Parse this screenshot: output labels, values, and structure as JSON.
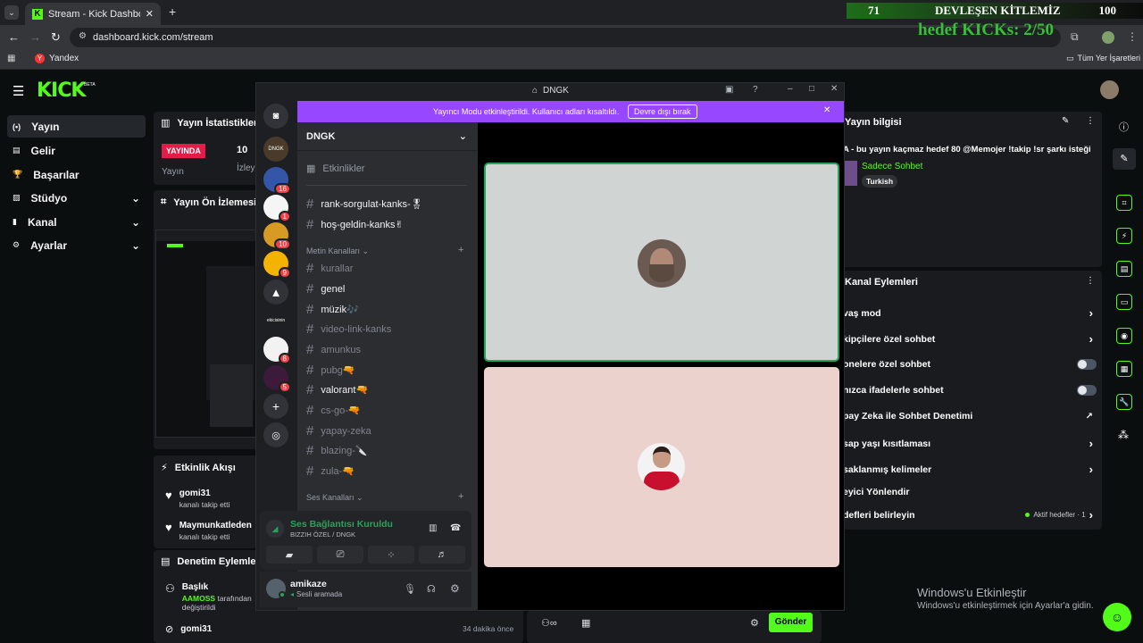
{
  "browser": {
    "tab_title": "Stream - Kick Dashboard",
    "url": "dashboard.kick.com/stream",
    "bookmark": "Yandex",
    "all_bookmarks": "Tüm Yer İşaretleri"
  },
  "overlay": {
    "count_left": "71",
    "title": "DEVLEŞEN KİTLEMİZ",
    "count_right": "100",
    "goal": "hedef KICKs: 2/50"
  },
  "kick": {
    "logo": "KICK",
    "beta": "BETA",
    "nav": [
      {
        "label": "Yayın"
      },
      {
        "label": "Gelir"
      },
      {
        "label": "Başarılar"
      },
      {
        "label": "Stüdyo"
      },
      {
        "label": "Kanal"
      },
      {
        "label": "Ayarlar"
      }
    ],
    "stats": {
      "title": "Yayın İstatistikleri",
      "live": "YAYINDA",
      "viewers": "10",
      "label1": "Yayın",
      "label2": "İzley"
    },
    "preview": {
      "title": "Yayın Ön İzlemesi"
    },
    "feed": {
      "title": "Etkinlik Akışı",
      "items": [
        {
          "name": "gomi31",
          "text": "kanalı takip etti"
        },
        {
          "name": "Maymunkatleden",
          "text": "kanalı takip etti"
        }
      ]
    },
    "mod": {
      "title": "Denetim Eylemleri",
      "items": [
        {
          "name": "Başlık",
          "actor": "AAMOSS",
          "text": "tarafından",
          "text2": "değiştirildi"
        },
        {
          "name": "gomi31",
          "time": "34 dakika önce"
        }
      ]
    },
    "info": {
      "title": "Yayın bilgisi",
      "stream_title": "A - bu yayın kaçmaz hedef 80 @Memojer !takip !sr şarkı isteği",
      "category": "Sadece Sohbet",
      "lang": "Turkish"
    },
    "actions": {
      "title": "Kanal Eylemleri",
      "rows": [
        "vaş mod",
        "kipçilere özel sohbet",
        "onelere özel sohbet",
        "nızca ifadelerle sohbet",
        "pay Zeka ile Sohbet Denetimi",
        "sap yaşı kısıtlaması",
        "saklanmış kelimeler",
        "eyici Yönlendir",
        "defleri belirleyin"
      ],
      "active_goals": "Aktif hedefler · 1"
    },
    "send": "Gönder"
  },
  "discord": {
    "window_title": "DNGK",
    "banner": "Yayıncı Modu etkinleştirildi. Kullanıcı adları kısaltıldı.",
    "banner_btn": "Devre dışı bırak",
    "server": "DNGK",
    "events": "Etkinlikler",
    "guilds": [
      {
        "label": "DNGK",
        "badge": ""
      },
      {
        "label": "",
        "badge": "16"
      },
      {
        "label": "",
        "badge": "1"
      },
      {
        "label": "",
        "badge": "10"
      },
      {
        "label": "",
        "badge": "9"
      },
      {
        "label": "",
        "badge": ""
      },
      {
        "label": "ekicisinin",
        "badge": ""
      },
      {
        "label": "",
        "badge": "8"
      },
      {
        "label": "",
        "badge": "5"
      }
    ],
    "channels_top": [
      "rank-sorgulat-kanks-🎖",
      "hoş-geldin-kanks✌"
    ],
    "text_cat": "Metin Kanalları",
    "channels": [
      "kurallar",
      "genel",
      "müzik🎶",
      "video-link-kanks",
      "amunkus",
      "pubg🔫",
      "valorant🔫",
      "cs-go-🔫",
      "yapay-zeka",
      "blazing-🔪",
      "zula-🔫"
    ],
    "voice_cat": "Ses Kanalları",
    "voice": {
      "status": "Ses Bağlantısı Kuruldu",
      "channel": "BIZZIH ÖZEL / DNGK"
    },
    "user": {
      "name": "amikaze",
      "status": "Sesli aramada"
    }
  },
  "windows": {
    "line1": "Windows'u Etkinleştir",
    "line2": "Windows'u etkinleştirmek için Ayarlar'a gidin."
  }
}
